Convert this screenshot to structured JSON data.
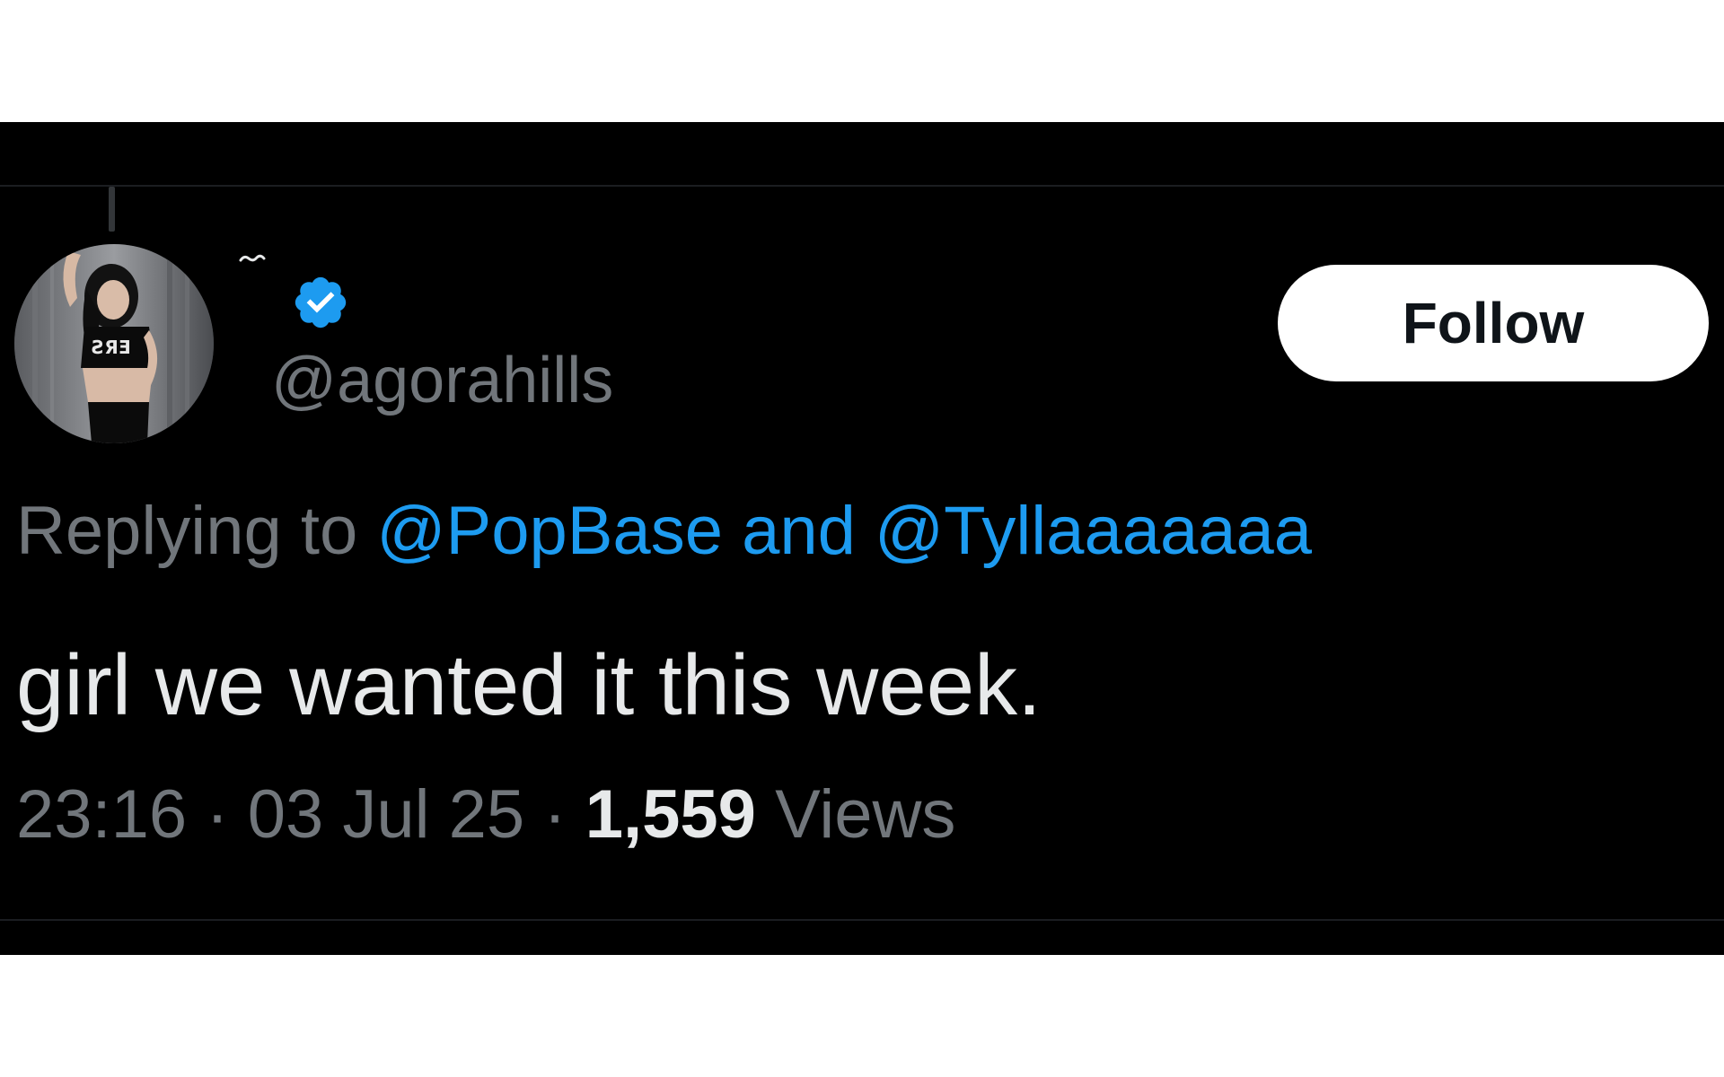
{
  "tweet": {
    "display_name": "~",
    "handle": "@agorahills",
    "follow_label": "Follow",
    "reply": {
      "prefix": "Replying to",
      "mention_1": "@PopBase",
      "conjunction": "and",
      "mention_2": "@Tyllaaaaaaa"
    },
    "text": "girl we wanted it this week.",
    "time": "23:16",
    "date": "03 Jul 25",
    "separator": "·",
    "views_count": "1,559",
    "views_label": "Views"
  },
  "icons": {
    "verified": "verified-badge-icon",
    "avatar": "profile-photo"
  },
  "colors": {
    "background": "#000000",
    "mention": "#1d9bf0",
    "secondary_text": "#71767b",
    "primary_text": "#e7e9ea",
    "verified": "#1d9bf0",
    "follow_button_bg": "#ffffff"
  }
}
